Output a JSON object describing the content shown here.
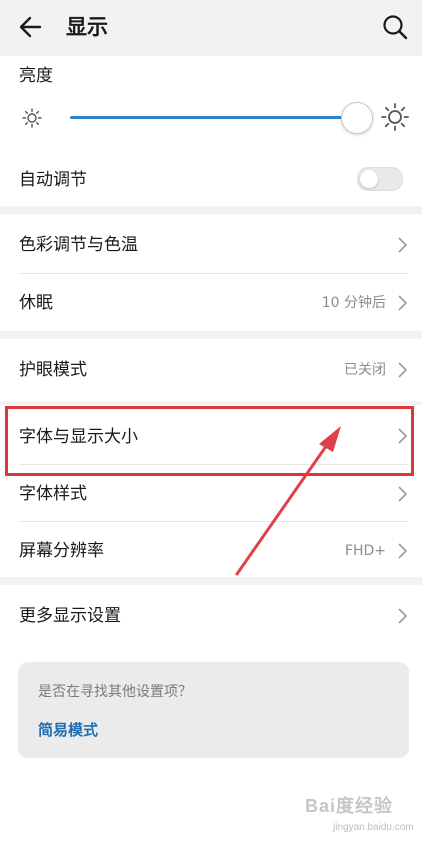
{
  "header": {
    "title": "显示",
    "back_icon": "back-arrow-icon",
    "search_icon": "search-icon"
  },
  "brightness": {
    "label": "亮度",
    "level_percent": 91
  },
  "auto_adjust": {
    "label": "自动调节",
    "enabled": false
  },
  "color_group": [
    {
      "label": "色彩调节与色温",
      "value": ""
    },
    {
      "label": "休眠",
      "value": "10 分钟后"
    }
  ],
  "eye_group": [
    {
      "label": "护眼模式",
      "value": "已关闭"
    }
  ],
  "font_group": [
    {
      "label": "字体与显示大小",
      "value": ""
    },
    {
      "label": "字体样式",
      "value": ""
    },
    {
      "label": "屏幕分辨率",
      "value": "FHD+"
    }
  ],
  "more_group": [
    {
      "label": "更多显示设置",
      "value": ""
    }
  ],
  "hint": {
    "question": "是否在寻找其他设置项？",
    "link": "简易模式"
  },
  "watermark": {
    "logo": "Bai度经验",
    "url": "jingyan.baidu.com"
  },
  "colors": {
    "accent": "#2f84c8",
    "highlight": "#d9383a",
    "arrow": "#e0404a",
    "link": "#1f6fb2"
  }
}
